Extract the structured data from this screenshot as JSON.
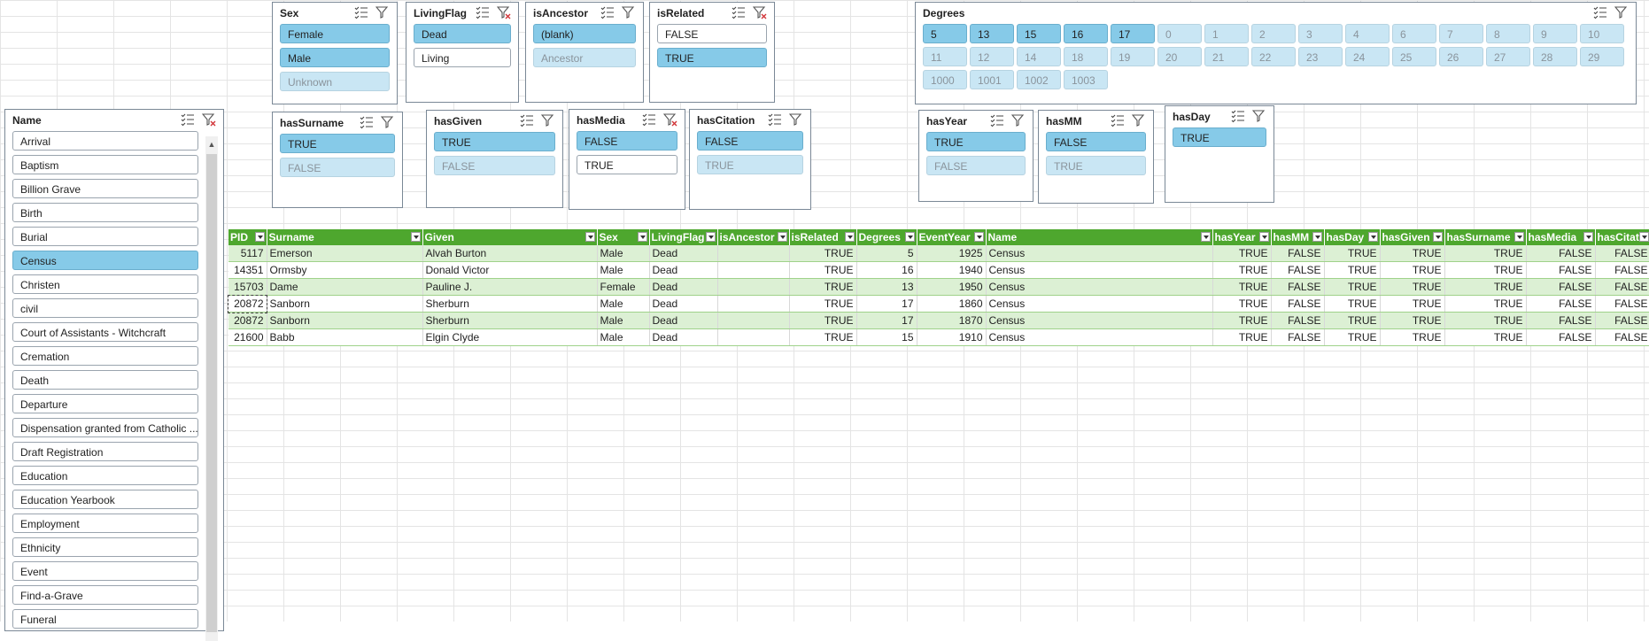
{
  "slicers": {
    "sex": {
      "title": "Sex",
      "items": [
        {
          "label": "Female",
          "state": "sel"
        },
        {
          "label": "Male",
          "state": "sel"
        },
        {
          "label": "Unknown",
          "state": "nodata"
        }
      ]
    },
    "livingflag": {
      "title": "LivingFlag",
      "items": [
        {
          "label": "Dead",
          "state": "sel"
        },
        {
          "label": "Living",
          "state": "unsel"
        }
      ]
    },
    "isancestor": {
      "title": "isAncestor",
      "items": [
        {
          "label": "(blank)",
          "state": "sel"
        },
        {
          "label": "Ancestor",
          "state": "nodata"
        }
      ]
    },
    "isrelated": {
      "title": "isRelated",
      "items": [
        {
          "label": "FALSE",
          "state": "unsel"
        },
        {
          "label": "TRUE",
          "state": "sel"
        }
      ]
    },
    "degrees": {
      "title": "Degrees",
      "items": [
        {
          "label": "5",
          "state": "sel"
        },
        {
          "label": "13",
          "state": "sel"
        },
        {
          "label": "15",
          "state": "sel"
        },
        {
          "label": "16",
          "state": "sel"
        },
        {
          "label": "17",
          "state": "sel"
        },
        {
          "label": "0",
          "state": "nodata"
        },
        {
          "label": "1",
          "state": "nodata"
        },
        {
          "label": "2",
          "state": "nodata"
        },
        {
          "label": "3",
          "state": "nodata"
        },
        {
          "label": "4",
          "state": "nodata"
        },
        {
          "label": "6",
          "state": "nodata"
        },
        {
          "label": "7",
          "state": "nodata"
        },
        {
          "label": "8",
          "state": "nodata"
        },
        {
          "label": "9",
          "state": "nodata"
        },
        {
          "label": "10",
          "state": "nodata"
        },
        {
          "label": "11",
          "state": "nodata"
        },
        {
          "label": "12",
          "state": "nodata"
        },
        {
          "label": "14",
          "state": "nodata"
        },
        {
          "label": "18",
          "state": "nodata"
        },
        {
          "label": "19",
          "state": "nodata"
        },
        {
          "label": "20",
          "state": "nodata"
        },
        {
          "label": "21",
          "state": "nodata"
        },
        {
          "label": "22",
          "state": "nodata"
        },
        {
          "label": "23",
          "state": "nodata"
        },
        {
          "label": "24",
          "state": "nodata"
        },
        {
          "label": "25",
          "state": "nodata"
        },
        {
          "label": "26",
          "state": "nodata"
        },
        {
          "label": "27",
          "state": "nodata"
        },
        {
          "label": "28",
          "state": "nodata"
        },
        {
          "label": "29",
          "state": "nodata"
        },
        {
          "label": "1000",
          "state": "nodata"
        },
        {
          "label": "1001",
          "state": "nodata"
        },
        {
          "label": "1002",
          "state": "nodata"
        },
        {
          "label": "1003",
          "state": "nodata"
        }
      ]
    },
    "hassurname": {
      "title": "hasSurname",
      "items": [
        {
          "label": "TRUE",
          "state": "sel"
        },
        {
          "label": "FALSE",
          "state": "nodata"
        }
      ]
    },
    "hasgiven": {
      "title": "hasGiven",
      "items": [
        {
          "label": "TRUE",
          "state": "sel"
        },
        {
          "label": "FALSE",
          "state": "nodata"
        }
      ]
    },
    "hasmedia": {
      "title": "hasMedia",
      "items": [
        {
          "label": "FALSE",
          "state": "sel"
        },
        {
          "label": "TRUE",
          "state": "unsel"
        }
      ]
    },
    "hascitation": {
      "title": "hasCitation",
      "items": [
        {
          "label": "FALSE",
          "state": "sel"
        },
        {
          "label": "TRUE",
          "state": "nodata"
        }
      ]
    },
    "hasyear": {
      "title": "hasYear",
      "items": [
        {
          "label": "TRUE",
          "state": "sel"
        },
        {
          "label": "FALSE",
          "state": "nodata"
        }
      ]
    },
    "hasmm": {
      "title": "hasMM",
      "items": [
        {
          "label": "FALSE",
          "state": "sel"
        },
        {
          "label": "TRUE",
          "state": "nodata"
        }
      ]
    },
    "hasday": {
      "title": "hasDay",
      "items": [
        {
          "label": "TRUE",
          "state": "sel"
        }
      ]
    },
    "name": {
      "title": "Name",
      "items": [
        {
          "label": "Arrival",
          "state": "unsel"
        },
        {
          "label": "Baptism",
          "state": "unsel"
        },
        {
          "label": "Billion Grave",
          "state": "unsel"
        },
        {
          "label": "Birth",
          "state": "unsel"
        },
        {
          "label": "Burial",
          "state": "unsel"
        },
        {
          "label": "Census",
          "state": "sel"
        },
        {
          "label": "Christen",
          "state": "unsel"
        },
        {
          "label": "civil",
          "state": "unsel"
        },
        {
          "label": "Court of Assistants - Witchcraft",
          "state": "unsel"
        },
        {
          "label": "Cremation",
          "state": "unsel"
        },
        {
          "label": "Death",
          "state": "unsel"
        },
        {
          "label": "Departure",
          "state": "unsel"
        },
        {
          "label": "Dispensation granted from Catholic ...",
          "state": "unsel"
        },
        {
          "label": "Draft Registration",
          "state": "unsel"
        },
        {
          "label": "Education",
          "state": "unsel"
        },
        {
          "label": "Education Yearbook",
          "state": "unsel"
        },
        {
          "label": "Employment",
          "state": "unsel"
        },
        {
          "label": "Ethnicity",
          "state": "unsel"
        },
        {
          "label": "Event",
          "state": "unsel"
        },
        {
          "label": "Find-a-Grave",
          "state": "unsel"
        },
        {
          "label": "Funeral",
          "state": "unsel"
        }
      ]
    }
  },
  "table": {
    "headers": [
      {
        "label": "PID",
        "filtered": false
      },
      {
        "label": "Surname",
        "filtered": false
      },
      {
        "label": "Given",
        "filtered": false
      },
      {
        "label": "Sex",
        "filtered": false
      },
      {
        "label": "LivingFlag",
        "filtered": true
      },
      {
        "label": "isAncestor",
        "filtered": false
      },
      {
        "label": "isRelated",
        "filtered": true
      },
      {
        "label": "Degrees",
        "filtered": false
      },
      {
        "label": "EventYear",
        "filtered": false
      },
      {
        "label": "Name",
        "filtered": true
      },
      {
        "label": "hasYear",
        "filtered": false
      },
      {
        "label": "hasMM",
        "filtered": false
      },
      {
        "label": "hasDay",
        "filtered": false
      },
      {
        "label": "hasGiven",
        "filtered": false
      },
      {
        "label": "hasSurname",
        "filtered": false
      },
      {
        "label": "hasMedia",
        "filtered": true
      },
      {
        "label": "hasCitation",
        "filtered": false
      }
    ],
    "rows": [
      [
        "5117",
        "Emerson",
        "Alvah Burton",
        "Male",
        "Dead",
        "",
        "TRUE",
        "5",
        "1925",
        "Census",
        "TRUE",
        "FALSE",
        "TRUE",
        "TRUE",
        "TRUE",
        "FALSE",
        "FALSE"
      ],
      [
        "14351",
        "Ormsby",
        "Donald Victor",
        "Male",
        "Dead",
        "",
        "TRUE",
        "16",
        "1940",
        "Census",
        "TRUE",
        "FALSE",
        "TRUE",
        "TRUE",
        "TRUE",
        "FALSE",
        "FALSE"
      ],
      [
        "15703",
        "Dame",
        "Pauline J.",
        "Female",
        "Dead",
        "",
        "TRUE",
        "13",
        "1950",
        "Census",
        "TRUE",
        "FALSE",
        "TRUE",
        "TRUE",
        "TRUE",
        "FALSE",
        "FALSE"
      ],
      [
        "20872",
        "Sanborn",
        "Sherburn",
        "Male",
        "Dead",
        "",
        "TRUE",
        "17",
        "1860",
        "Census",
        "TRUE",
        "FALSE",
        "TRUE",
        "TRUE",
        "TRUE",
        "FALSE",
        "FALSE"
      ],
      [
        "20872",
        "Sanborn",
        "Sherburn",
        "Male",
        "Dead",
        "",
        "TRUE",
        "17",
        "1870",
        "Census",
        "TRUE",
        "FALSE",
        "TRUE",
        "TRUE",
        "TRUE",
        "FALSE",
        "FALSE"
      ],
      [
        "21600",
        "Babb",
        "Elgin Clyde",
        "Male",
        "Dead",
        "",
        "TRUE",
        "15",
        "1910",
        "Census",
        "TRUE",
        "FALSE",
        "TRUE",
        "TRUE",
        "TRUE",
        "FALSE",
        "FALSE"
      ]
    ]
  },
  "colors": {
    "header_green": "#4ea72e",
    "row_band": "#dcf0d4",
    "selected_item": "#86cae8",
    "nodata_item": "#c9e6f4"
  }
}
